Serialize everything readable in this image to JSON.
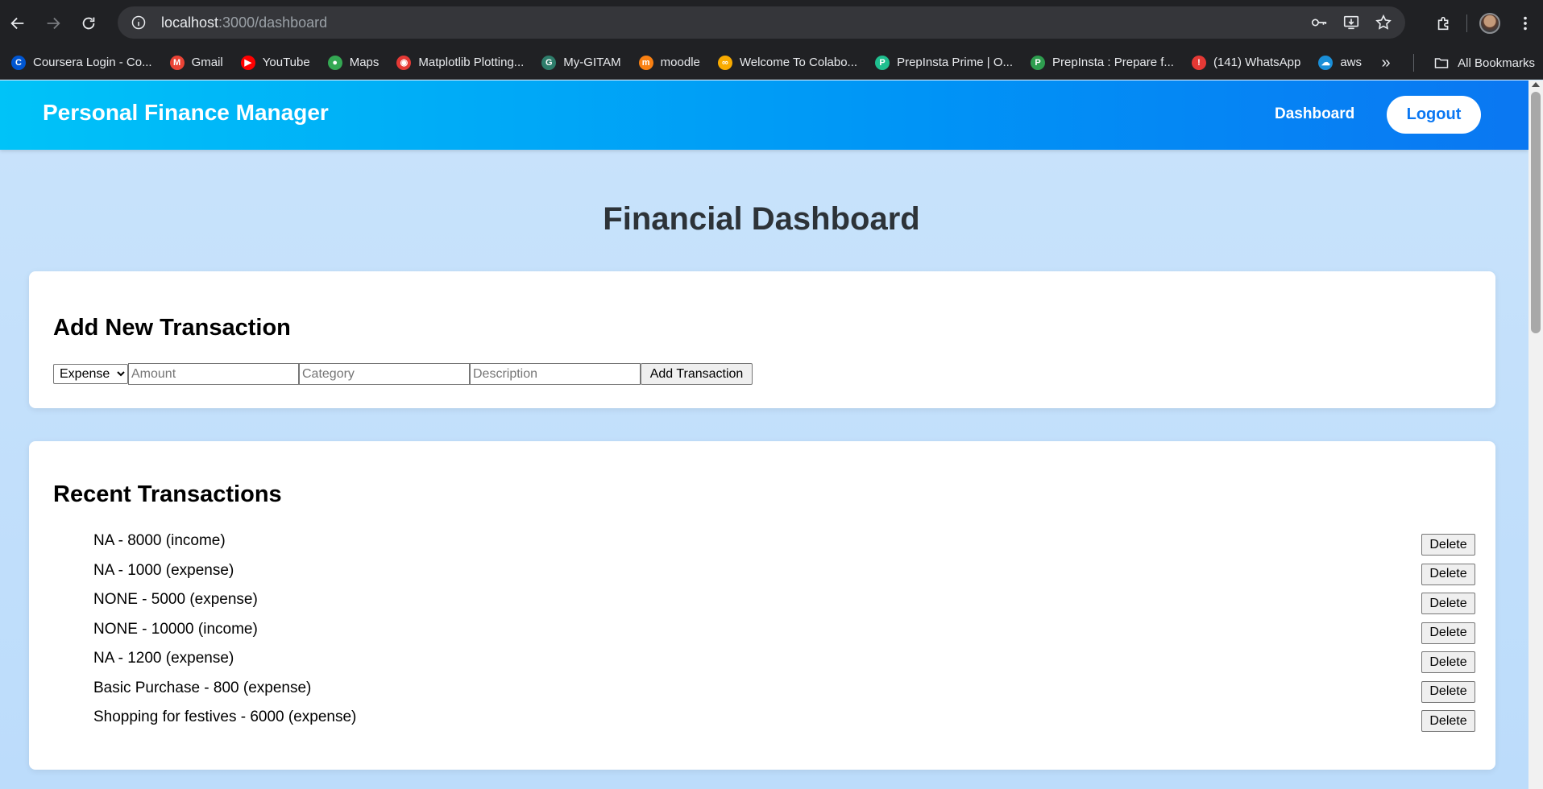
{
  "browser": {
    "url_host": "localhost",
    "url_path": ":3000/dashboard",
    "bookmarks": [
      {
        "label": "Coursera Login - Co...",
        "icon": "coursera-icon",
        "color": "#0056d2",
        "glyph": "C"
      },
      {
        "label": "Gmail",
        "icon": "gmail-icon",
        "color": "#ea4335",
        "glyph": "M"
      },
      {
        "label": "YouTube",
        "icon": "youtube-icon",
        "color": "#ff0000",
        "glyph": "▶"
      },
      {
        "label": "Maps",
        "icon": "maps-icon",
        "color": "#34a853",
        "glyph": "●"
      },
      {
        "label": "Matplotlib Plotting...",
        "icon": "matplotlib-icon",
        "color": "#e53935",
        "glyph": "◉"
      },
      {
        "label": "My-GITAM",
        "icon": "gitam-icon",
        "color": "#2e7d6b",
        "glyph": "G"
      },
      {
        "label": "moodle",
        "icon": "moodle-icon",
        "color": "#f98012",
        "glyph": "m"
      },
      {
        "label": "Welcome To Colabo...",
        "icon": "colab-icon",
        "color": "#f9ab00",
        "glyph": "∞"
      },
      {
        "label": "PrepInsta Prime | O...",
        "icon": "prepinsta-prime-icon",
        "color": "#1fbf8f",
        "glyph": "P"
      },
      {
        "label": "PrepInsta : Prepare f...",
        "icon": "prepinsta-icon",
        "color": "#2e9e4f",
        "glyph": "P"
      },
      {
        "label": "(141) WhatsApp",
        "icon": "whatsapp-icon",
        "color": "#e53935",
        "glyph": "!"
      },
      {
        "label": "aws",
        "icon": "aws-icon",
        "color": "#1a8fd8",
        "glyph": "☁"
      }
    ],
    "all_bookmarks_label": "All Bookmarks"
  },
  "header": {
    "brand": "Personal Finance Manager",
    "nav_dashboard": "Dashboard",
    "logout_label": "Logout"
  },
  "main": {
    "title": "Financial Dashboard"
  },
  "add_transaction": {
    "title": "Add New Transaction",
    "type_selected": "Expense",
    "amount_placeholder": "Amount",
    "category_placeholder": "Category",
    "description_placeholder": "Description",
    "submit_label": "Add Transaction"
  },
  "recent": {
    "title": "Recent Transactions",
    "delete_label": "Delete",
    "items": [
      {
        "text": "NA - 8000 (income)"
      },
      {
        "text": "NA - 1000 (expense)"
      },
      {
        "text": "NONE - 5000 (expense)"
      },
      {
        "text": "NONE - 10000 (income)"
      },
      {
        "text": "NA - 1200 (expense)"
      },
      {
        "text": "Basic Purchase - 800 (expense)"
      },
      {
        "text": "Shopping for festives - 6000 (expense)"
      }
    ]
  },
  "colors": {
    "header_gradient_start": "#00c3f8",
    "header_gradient_end": "#0a77f2",
    "page_background": "#c9e3fb",
    "card_background": "#ffffff"
  }
}
